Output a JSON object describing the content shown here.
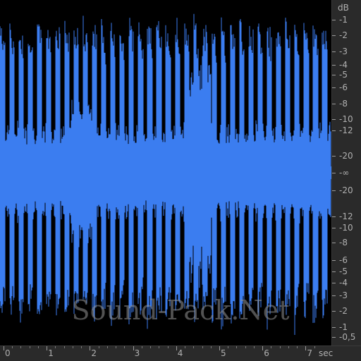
{
  "colors": {
    "waveform": "#3b7df0",
    "waveform_light": "#6aa2ff",
    "background": "#000000",
    "ruler": "#2a2a2a",
    "text": "#b0b0b0"
  },
  "db_scale": {
    "unit": "dB",
    "labels": [
      "-1",
      "-2",
      "-3",
      "-4",
      "-5",
      "-6",
      "-8",
      "-10",
      "-12",
      "-20",
      "-∞",
      "-20",
      "-12",
      "-10",
      "-8",
      "-6",
      "-5",
      "-4",
      "-3",
      "-2",
      "-1",
      "-0,5"
    ]
  },
  "time_ruler": {
    "unit": "sec",
    "labels": [
      "0",
      "1",
      "2",
      "3",
      "4",
      "5",
      "6",
      "7"
    ]
  },
  "watermark": "Sound-Pack.Net",
  "waveform": {
    "duration_sec": 7.6,
    "hit_count": 36
  }
}
